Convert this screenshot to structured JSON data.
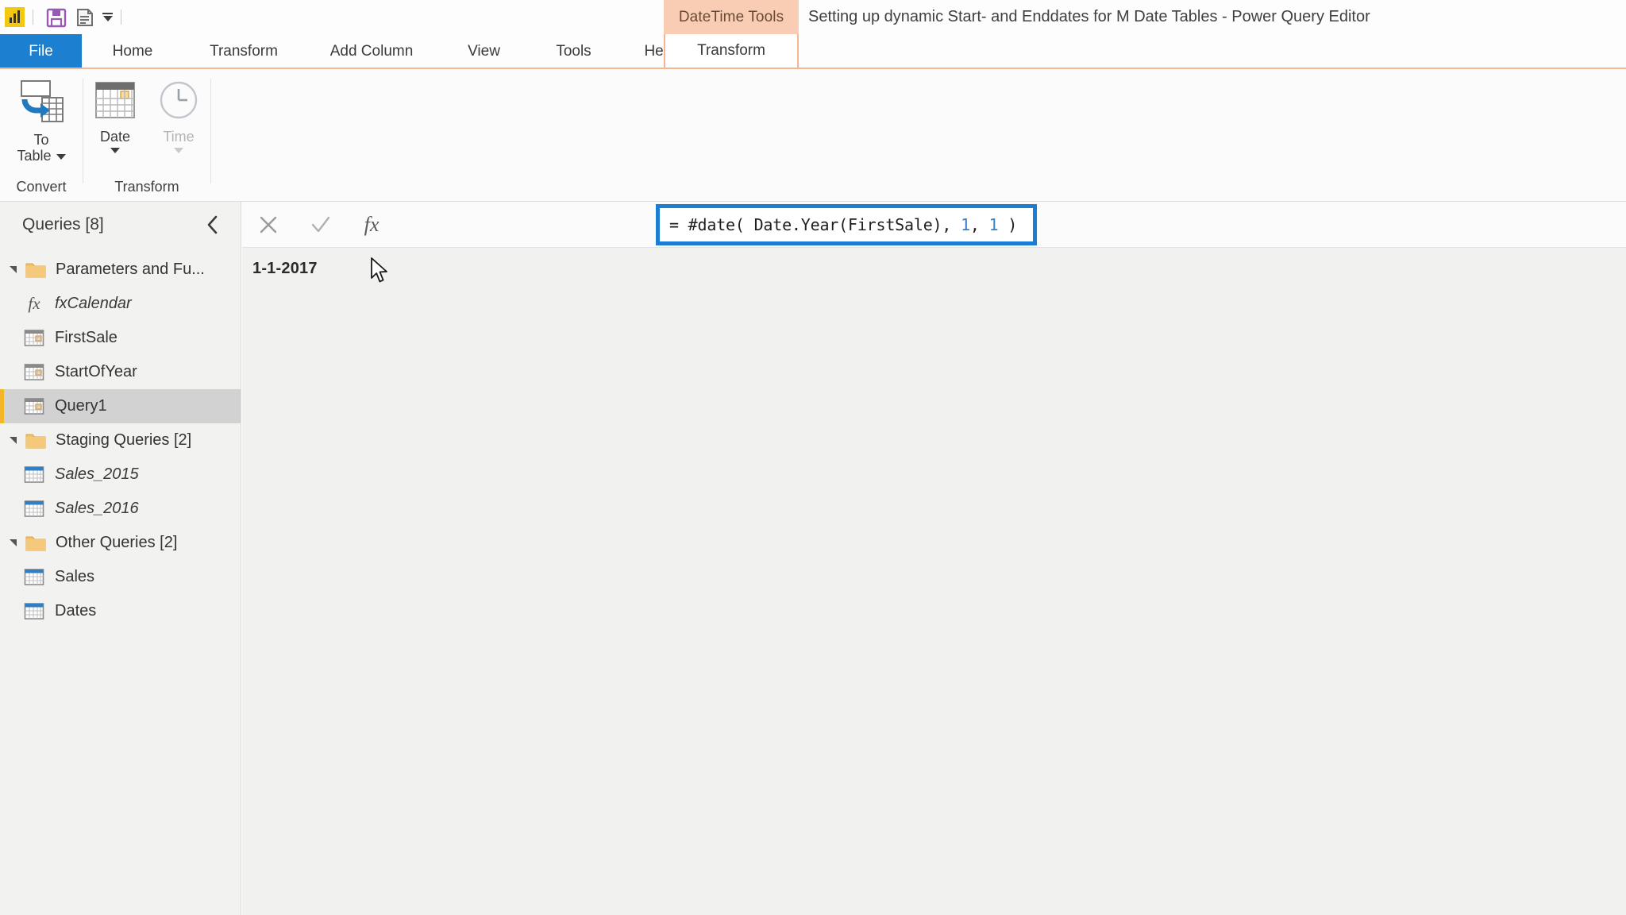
{
  "window": {
    "title": "Setting up dynamic Start- and Enddates for M Date Tables - Power Query Editor",
    "contextual_tools_label": "DateTime Tools",
    "accent_blue": "#1c7fd0",
    "contextual_peach": "#f8cdb4",
    "highlight_blue": "#1a7fd4",
    "selection_gray": "#d2d2d2",
    "selection_bar_yellow": "#f2b626"
  },
  "quick_access": {
    "app_icon": "power-bi-logo-icon",
    "items": [
      {
        "name": "save-icon",
        "label": "Save"
      },
      {
        "name": "document-icon",
        "label": "Recent Sources"
      },
      {
        "name": "customize-quick-access-caret-icon",
        "label": "Customize Quick Access Toolbar"
      }
    ]
  },
  "ribbon": {
    "tabs": [
      {
        "label": "File",
        "active": false,
        "style": "file"
      },
      {
        "label": "Home",
        "active": false,
        "style": "normal"
      },
      {
        "label": "Transform",
        "active": false,
        "style": "normal"
      },
      {
        "label": "Add Column",
        "active": false,
        "style": "normal"
      },
      {
        "label": "View",
        "active": false,
        "style": "normal"
      },
      {
        "label": "Tools",
        "active": false,
        "style": "normal"
      },
      {
        "label": "Help",
        "active": false,
        "style": "normal"
      },
      {
        "label": "Transform",
        "active": true,
        "style": "contextual"
      }
    ],
    "groups": [
      {
        "label": "Convert",
        "buttons": [
          {
            "label_line1": "To",
            "label_line2": "Table",
            "icon": "to-table-icon",
            "has_caret": true,
            "inline_caret": true,
            "disabled": false
          }
        ]
      },
      {
        "label": "Transform",
        "buttons": [
          {
            "label_line1": "Date",
            "label_line2": "",
            "icon": "calendar-icon",
            "has_caret": true,
            "inline_caret": false,
            "disabled": false
          },
          {
            "label_line1": "Time",
            "label_line2": "",
            "icon": "clock-icon",
            "has_caret": true,
            "inline_caret": false,
            "disabled": true
          }
        ]
      }
    ]
  },
  "queries_pane": {
    "header": "Queries [8]",
    "collapse_icon": "chevron-left-icon",
    "tree": [
      {
        "type": "folder",
        "label": "Parameters and Fu...",
        "indent": 0,
        "icon": "folder-icon",
        "expanded": true,
        "italic": false,
        "selected": false
      },
      {
        "type": "function",
        "label": "fxCalendar",
        "indent": 1,
        "icon": "fx-icon",
        "italic": true,
        "selected": false
      },
      {
        "type": "query",
        "label": "FirstSale",
        "indent": 1,
        "icon": "date-table-icon",
        "italic": false,
        "selected": false
      },
      {
        "type": "query",
        "label": "StartOfYear",
        "indent": 1,
        "icon": "date-table-icon",
        "italic": false,
        "selected": false
      },
      {
        "type": "query",
        "label": "Query1",
        "indent": 1,
        "icon": "date-table-icon",
        "italic": false,
        "selected": true
      },
      {
        "type": "folder",
        "label": "Staging Queries [2]",
        "indent": 0,
        "icon": "folder-icon",
        "expanded": true,
        "italic": false,
        "selected": false
      },
      {
        "type": "query",
        "label": "Sales_2015",
        "indent": 1,
        "icon": "table-icon",
        "italic": true,
        "selected": false
      },
      {
        "type": "query",
        "label": "Sales_2016",
        "indent": 1,
        "icon": "table-icon",
        "italic": true,
        "selected": false
      },
      {
        "type": "folder",
        "label": "Other Queries [2]",
        "indent": 0,
        "icon": "folder-icon",
        "expanded": true,
        "italic": false,
        "selected": false
      },
      {
        "type": "query",
        "label": "Sales",
        "indent": 1,
        "icon": "table-icon",
        "italic": false,
        "selected": false
      },
      {
        "type": "query",
        "label": "Dates",
        "indent": 1,
        "icon": "table-icon",
        "italic": false,
        "selected": false
      }
    ]
  },
  "formula_bar": {
    "cancel_icon": "close-icon",
    "accept_icon": "checkmark-icon",
    "fx_icon": "fx-icon",
    "formula_prefix": "= #date( Date.Year(FirstSale), ",
    "formula_arg_month": "1",
    "formula_sep": ", ",
    "formula_arg_day": "1",
    "formula_suffix": " )",
    "formula_full": "= #date( Date.Year(FirstSale), 1, 1 )",
    "highlighted": true
  },
  "result": {
    "value": "1-1-2017",
    "cursor_icon": "mouse-pointer-icon"
  }
}
